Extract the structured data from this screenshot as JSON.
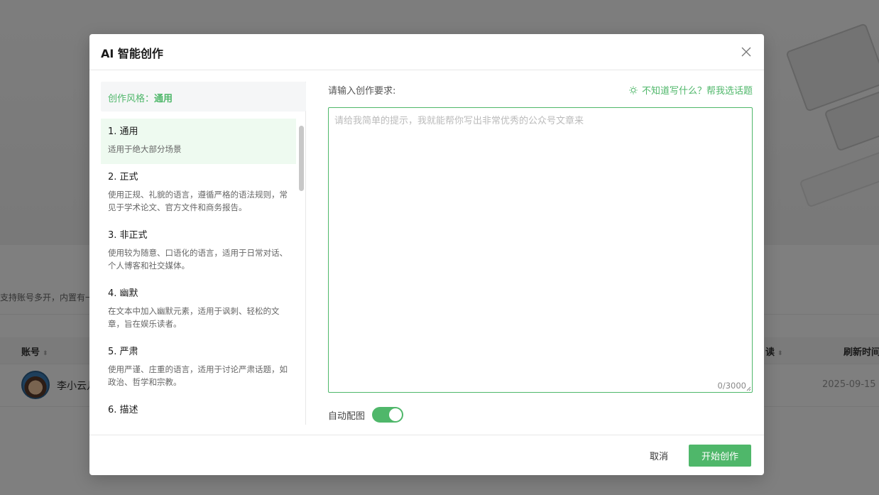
{
  "background": {
    "description_fragment": "支持账号多开，内置有一",
    "table_headers": [
      "账号",
      "读",
      "刷新时间"
    ],
    "row": {
      "name": "李小云儿",
      "date": "2025-09-15"
    }
  },
  "modal": {
    "title": "AI 智能创作",
    "style_header": {
      "label": "创作风格：",
      "value": "通用"
    },
    "styles": [
      {
        "name": "1. 通用",
        "desc": "适用于绝大部分场景",
        "active": true
      },
      {
        "name": "2. 正式",
        "desc": "使用正规、礼貌的语言，遵循严格的语法规则，常见于学术论文、官方文件和商务报告。",
        "active": false
      },
      {
        "name": "3. 非正式",
        "desc": "使用较为随意、口语化的语言，适用于日常对话、个人博客和社交媒体。",
        "active": false
      },
      {
        "name": "4. 幽默",
        "desc": "在文本中加入幽默元素，适用于讽刺、轻松的文章，旨在娱乐读者。",
        "active": false
      },
      {
        "name": "5. 严肃",
        "desc": "使用严谨、庄重的语言，适用于讨论严肃话题，如政治、哲学和宗教。",
        "active": false
      },
      {
        "name": "6. 描述",
        "desc": "",
        "active": false
      }
    ],
    "prompt": {
      "label": "请输入创作要求:",
      "suggest": "不知道写什么？帮我选话题",
      "placeholder": "请给我简单的提示，我就能帮你写出非常优秀的公众号文章来",
      "value": "",
      "count": "0/3000"
    },
    "auto_image": {
      "label": "自动配图",
      "enabled": true
    },
    "footer": {
      "cancel": "取消",
      "start": "开始创作"
    }
  },
  "colors": {
    "accent": "#4fb76a",
    "active_bg": "#eefaf0"
  },
  "icons": {
    "close": "close-icon",
    "suggest": "bulb-icon"
  }
}
